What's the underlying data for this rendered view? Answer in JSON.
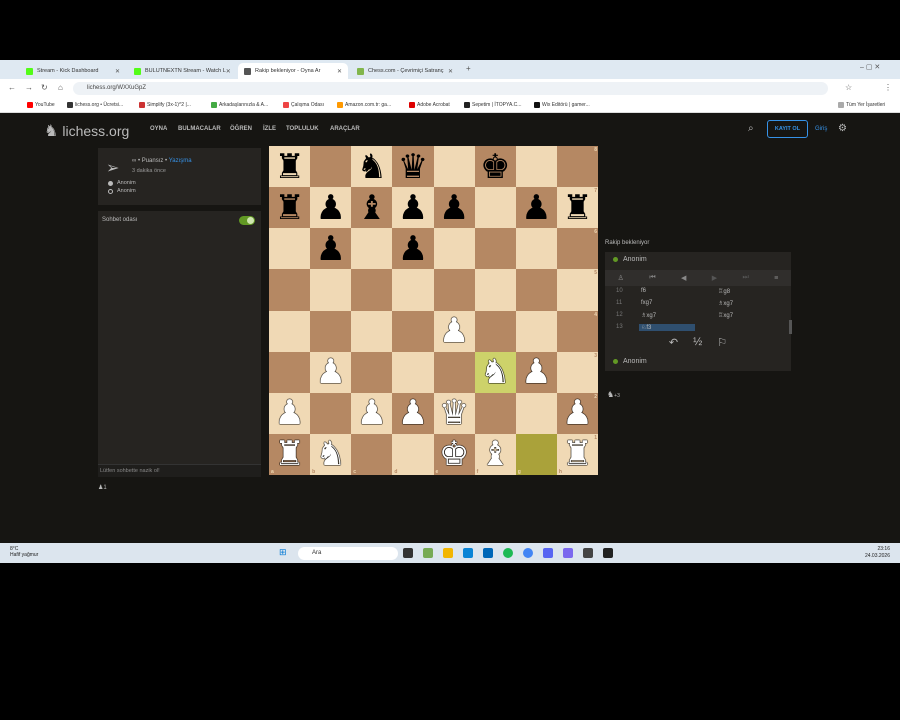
{
  "browser": {
    "tabs": [
      {
        "label": "Stream - Kick Dashboard",
        "color": "#53fc18"
      },
      {
        "label": "BULUTNEXTN Stream - Watch L",
        "color": "#53fc18"
      },
      {
        "label": "Rakip bekleniyor - Oyna Ar",
        "color": "#555555"
      },
      {
        "label": "Chess.com - Çevrimiçi Satranç",
        "color": "#81b64c"
      }
    ],
    "url": "lichess.org/WXXuGpZ",
    "bookmarks": [
      "YouTube",
      "lichess.org • Ücretsi...",
      "Simplify (3x-1)^2 |...",
      "Arkadaşlarınızla & A...",
      "Çalışma Odası",
      "Amazon.com.tr: ga...",
      "Adobe Acrobat",
      "Sepetim | İTOPYA.C...",
      "Wix Editörü | gamer..."
    ],
    "all_bookmarks": "Tüm Yer İşaretleri"
  },
  "site": {
    "logo": "lichess.org",
    "nav": [
      "OYNA",
      "BULMACALAR",
      "ÖĞREN",
      "İZLE",
      "TOPLULUK",
      "ARAÇLAR"
    ],
    "signup": "KAYIT OL",
    "login": "Giriş"
  },
  "game_info": {
    "line1_a": "∞ • Puansız •",
    "line1_b": "Yazışma",
    "time": "3 dakika önce",
    "players": [
      "Anonim",
      "Anonim"
    ]
  },
  "chat": {
    "title": "Sohbet odası",
    "placeholder": "Lütfen sohbette nazik ol!",
    "watchers": "1"
  },
  "board": {
    "rows": [
      "r.nq.k...",
      "rpbpp.prp",
      ".p.p....",
      "........",
      "....P...",
      ".P...NP.",
      "P.PPQ..P",
      "RN..KB.R"
    ],
    "highlight": [
      "f3",
      "g1"
    ],
    "files": [
      "a",
      "b",
      "c",
      "d",
      "e",
      "f",
      "g",
      "h"
    ],
    "ranks": [
      "8",
      "7",
      "6",
      "5",
      "4",
      "3",
      "2",
      "1"
    ]
  },
  "right": {
    "status": "Rakip bekleniyor",
    "top_player": "Anonim",
    "bottom_player": "Anonim",
    "moves": [
      {
        "n": "10",
        "w": "f6",
        "b": "♖g8"
      },
      {
        "n": "11",
        "w": "fxg7",
        "b": "♗xg7"
      },
      {
        "n": "12",
        "w": "♗xg7",
        "b": "♖xg7"
      },
      {
        "n": "13",
        "w": "♘f3",
        "b": ""
      }
    ],
    "spectators": "+3"
  },
  "taskbar": {
    "weather_temp": "8°C",
    "weather_text": "Hafif yağmur",
    "search": "Ara",
    "time": "23:16",
    "date": "24.03.2026"
  }
}
